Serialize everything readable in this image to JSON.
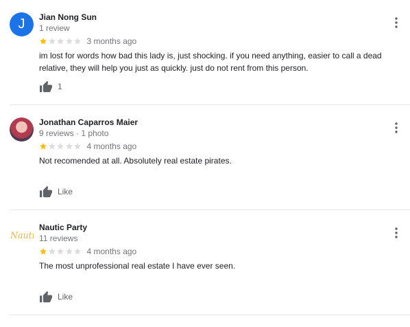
{
  "reviews": [
    {
      "reviewer": "Jian Nong Sun",
      "meta": "1 review",
      "avatar_letter": "J",
      "rating": 1,
      "time": "3 months ago",
      "text": "im lost for words how bad this lady is, just shocking.  if you need anything, easier to call a dead relative, they will help you just as quickly. just do not rent from this person.",
      "like_label": "1"
    },
    {
      "reviewer": "Jonathan Caparros Maier",
      "meta": "9 reviews · 1 photo",
      "rating": 1,
      "time": "4 months ago",
      "text": "Not recomended at all. Absolutely real estate pirates.",
      "like_label": "Like"
    },
    {
      "reviewer": "Nautic Party",
      "meta": "11 reviews",
      "avatar_logo": "Nautic",
      "rating": 1,
      "time": "4 months ago",
      "text": "The most unprofessional real estate I have ever seen.",
      "like_label": "Like"
    }
  ],
  "colors": {
    "star_filled": "#fbbc04",
    "star_empty": "#dadce0",
    "avatar_blue": "#1a73e8",
    "logo_gold": "#e8b93a"
  },
  "icons": [
    "more-vert-icon",
    "thumb-up-icon",
    "star-icon"
  ]
}
